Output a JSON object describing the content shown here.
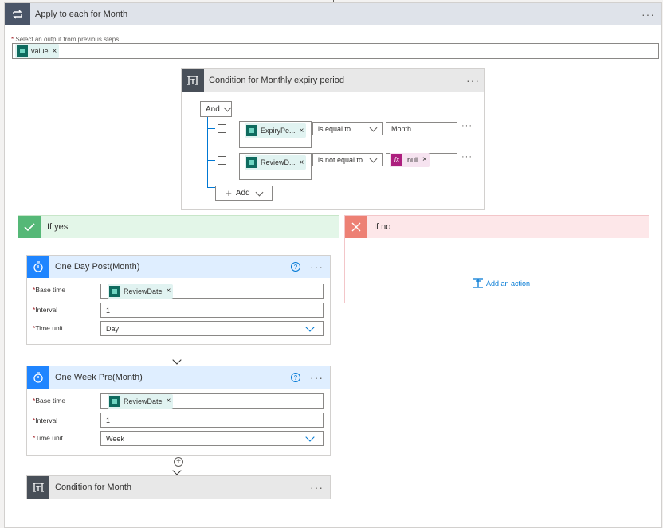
{
  "loop": {
    "title": "Apply to each for Month",
    "select_label": "Select an output from previous steps",
    "token": "value"
  },
  "condition": {
    "title": "Condition for Monthly expiry period",
    "group_op": "And",
    "rows": [
      {
        "left": "ExpiryPe...",
        "operator": "is equal to",
        "right": "Month"
      },
      {
        "left": "ReviewD...",
        "operator": "is not equal to",
        "right": "null",
        "right_fx": "fx"
      }
    ],
    "add_label": "Add"
  },
  "yes": {
    "title": "If yes"
  },
  "no": {
    "title": "If no",
    "add_action": "Add an action"
  },
  "step1": {
    "title": "One Day Post(Month)",
    "base_time_label": "Base time",
    "base_time": "ReviewDate",
    "interval_label": "Interval",
    "interval": "1",
    "unit_label": "Time unit",
    "unit": "Day"
  },
  "step2": {
    "title": "One Week Pre(Month)",
    "base_time_label": "Base time",
    "base_time": "ReviewDate",
    "interval_label": "Interval",
    "interval": "1",
    "unit_label": "Time unit",
    "unit": "Week"
  },
  "step3": {
    "title": "Condition for Month"
  },
  "colors": {
    "loop": "#4a5568",
    "condition": "#484f58",
    "yes_hdr": "#e3f6e8",
    "yes_icon": "#55b877",
    "no_hdr": "#fde7e9",
    "no_icon": "#ed8074",
    "delay": "#1f85ff"
  }
}
